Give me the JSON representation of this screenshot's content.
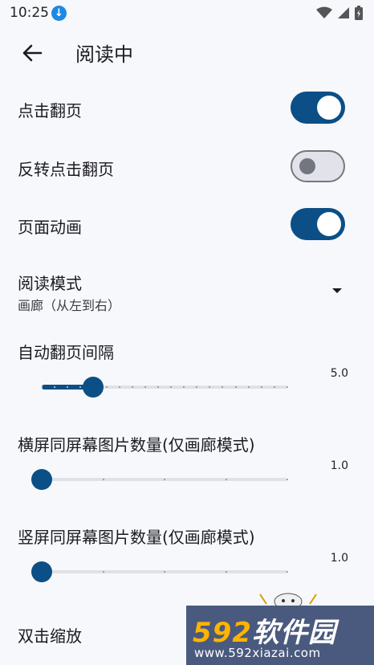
{
  "status_bar": {
    "time": "10:25",
    "icons": [
      "download-icon",
      "wifi-icon",
      "signal-icon",
      "battery-icon"
    ]
  },
  "toolbar": {
    "back_icon": "arrow-left-icon",
    "title": "阅读中"
  },
  "settings": {
    "tap_page_turn": {
      "label": "点击翻页",
      "checked": true
    },
    "reverse_tap": {
      "label": "反转点击翻页",
      "checked": false
    },
    "page_animation": {
      "label": "页面动画",
      "checked": true
    },
    "read_mode": {
      "label": "阅读模式",
      "value": "画廊（从左到右）"
    },
    "auto_page_interval": {
      "label": "自动翻页间隔",
      "value": "5.0",
      "min": 1,
      "max": 20,
      "current": 5.0
    },
    "landscape_images": {
      "label": "横屏同屏幕图片数量(仅画廊模式)",
      "value": "1.0",
      "min": 1,
      "max": 5,
      "current": 1.0
    },
    "portrait_images": {
      "label": "竖屏同屏幕图片数量(仅画廊模式)",
      "value": "1.0",
      "min": 1,
      "max": 5,
      "current": 1.0
    },
    "double_tap_zoom": {
      "label": "双击缩放"
    }
  },
  "watermark": {
    "logo_num": "592",
    "logo_text": "软件园",
    "url": "www.592xiazai.com"
  },
  "colors": {
    "accent": "#0b4f86",
    "background": "#f7f8fb"
  }
}
